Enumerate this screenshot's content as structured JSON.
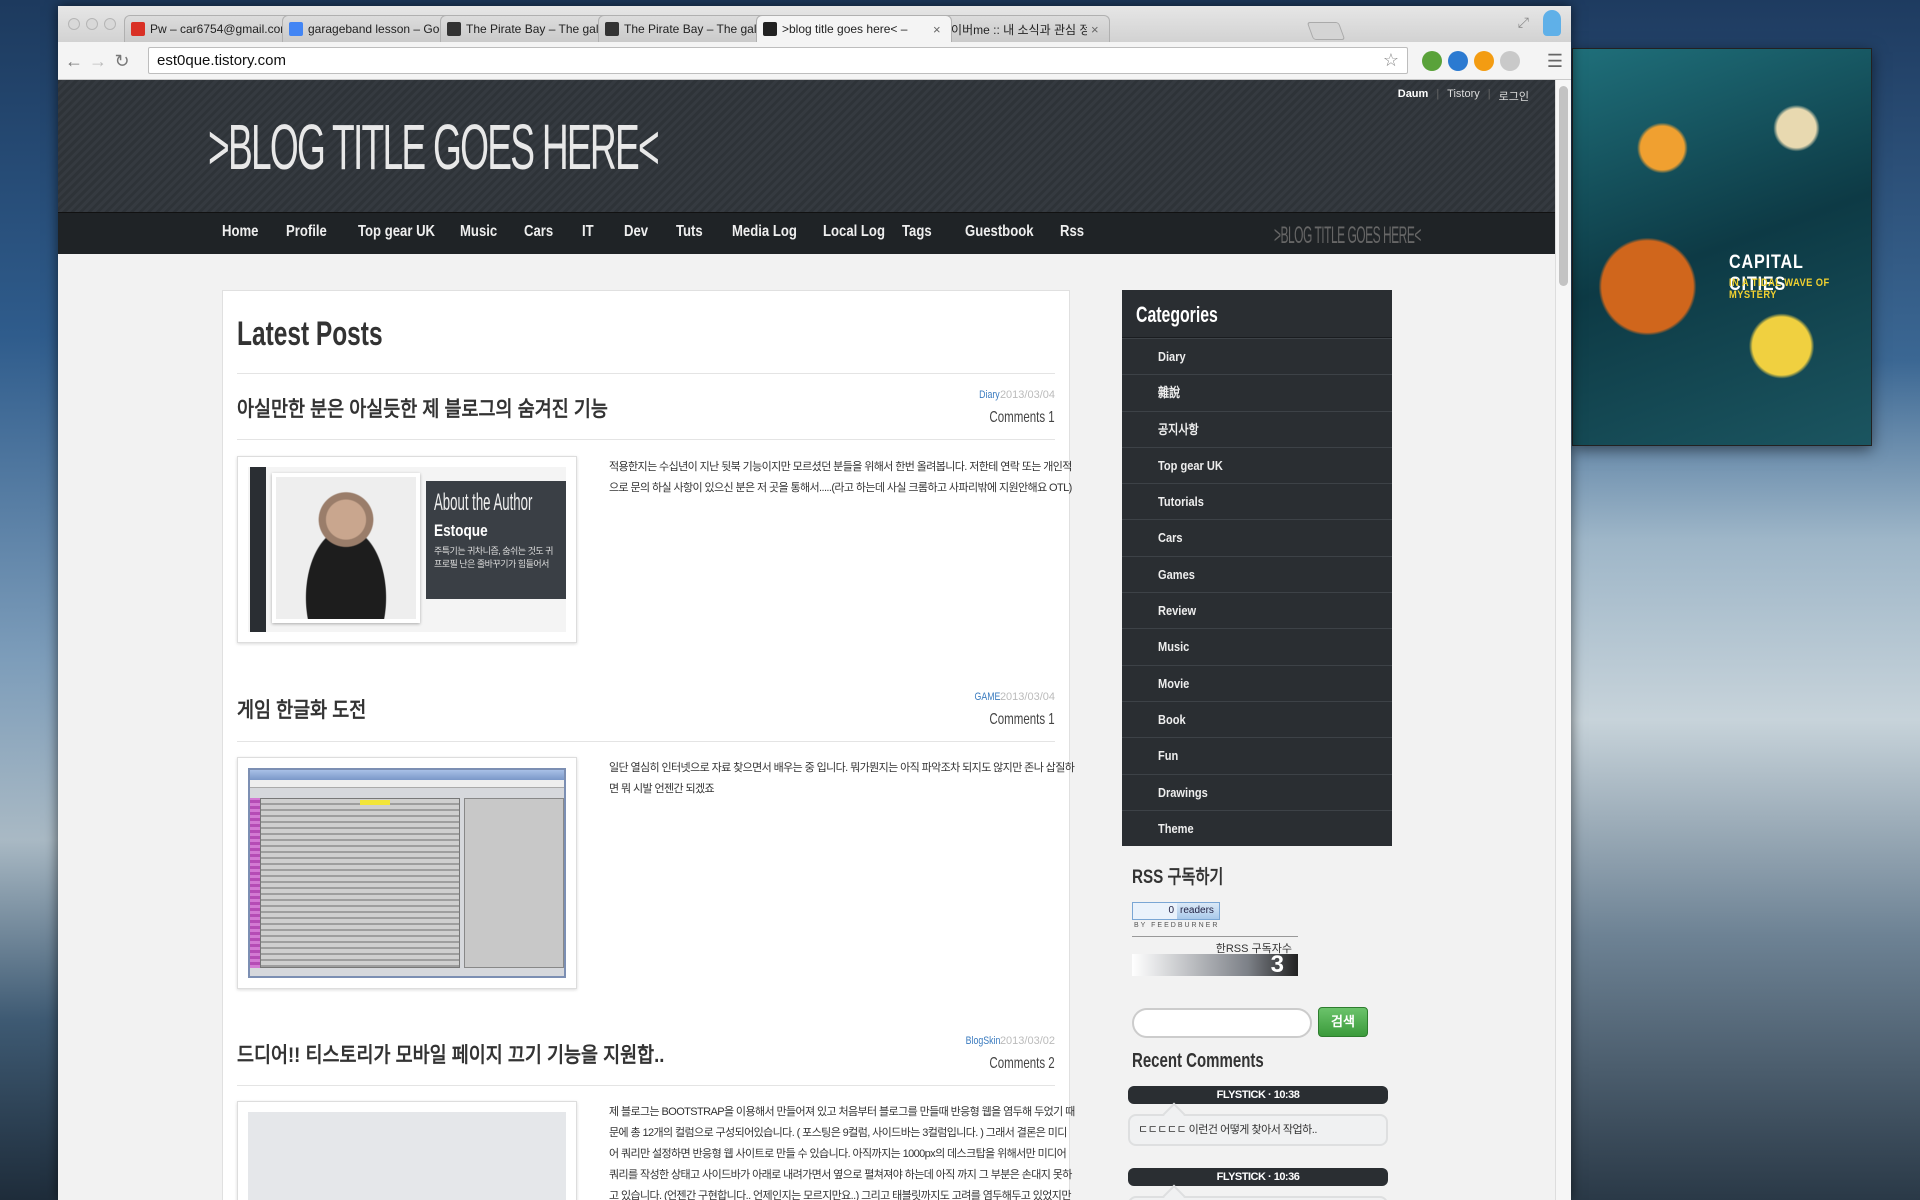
{
  "browser": {
    "tabs": [
      {
        "title": "Pw – car6754@gmail.com",
        "icon": "gmail-icon",
        "color": "#d93025"
      },
      {
        "title": "garageband lesson – Goog",
        "icon": "google-icon",
        "color": "#4285f4"
      },
      {
        "title": "The Pirate Bay – The galaxy",
        "icon": "pirate-ship-icon",
        "color": "#333333"
      },
      {
        "title": "The Pirate Bay – The galaxy",
        "icon": "pirate-ship-icon",
        "color": "#333333"
      },
      {
        "title": ">blog title goes here< –",
        "icon": "blog-icon",
        "color": "#222222"
      },
      {
        "title": "네이버me :: 내 소식과 관심 정",
        "icon": "naver-me-icon",
        "color": "#2db400"
      }
    ],
    "active_tab": 4,
    "url": "est0que.tistory.com"
  },
  "desktop": {
    "album_title": "CAPITAL CITIES",
    "album_subtitle": "IN A TIDAL WAVE OF MYSTERY"
  },
  "site": {
    "toplinks": [
      "Daum",
      "Tistory",
      "로그인"
    ],
    "blog_title": ">BLOG TITLE GOES HERE<",
    "nav": [
      "Home",
      "Profile",
      "Top gear UK",
      "Music",
      "Cars",
      "IT",
      "Dev",
      "Tuts",
      "Media Log",
      "Local Log",
      "Tags",
      "Guestbook",
      "Rss"
    ],
    "nav_logo": ">BLOG TITLE GOES HERE<"
  },
  "main": {
    "heading": "Latest Posts",
    "posts": [
      {
        "title": "아실만한 분은 아실듯한 제 블로그의 숨겨진 기능",
        "category": "Diary",
        "date": "2013/03/04",
        "comments": "Comments 1",
        "excerpt": "적용한지는 수십년이 지난 뒷북 기능이지만 모르셨던 분들을 위해서 한번 올려봅니다. 저한테 연락 또는 개인적으로 문의 하실 사항이 있으신 분은 저 곳을 통해서.....(라고 하는데 사실 크롬하고 사파리밖에 지원안해요 OTL)",
        "author_card": {
          "heading": "About the Author",
          "name": "Estoque",
          "desc": "주특기는 귀차니즘, 숨쉬는 것도 귀\n프로필 난은 줄바꾸기가 힘들어서"
        }
      },
      {
        "title": "게임 한글화 도전",
        "category": "GAME",
        "date": "2013/03/04",
        "comments": "Comments 1",
        "excerpt": "일단 열심히 인터넷으로 자료 찾으면서 배우는 중 입니다. 뭐가뭔지는 아직 파악조차 되지도 않지만 존나 삽질하면 뭐 시발 언젠간 되겠죠"
      },
      {
        "title": "드디어!! 티스토리가 모바일 페이지 끄기 기능을 지원합..",
        "category": "BlogSkin",
        "date": "2013/03/02",
        "comments": "Comments 2",
        "excerpt": "제 블로그는 BOOTSTRAP을 이용해서 만들어져 있고 처음부터 블로그를 만들때 반응형 웹을 염두해 두었기 때문에 총 12개의 컬럼으로 구성되어있습니다. ( 포스팅은 9컬럼, 사이드바는 3컬럼입니다. ) 그래서 결론은 미디어 쿼리만 설정하면 반응형 웹 사이트로 만들 수 있습니다. 아직까지는 1000px의 데스크탑을 위해서만 미디어 쿼리를 작성한 상태고 사이드바가 아래로 내려가면서 옆으로 펼쳐져야 하는데 아직 까지 그 부분은 손대지 못하고 있습니다. (언젠간 구현합니다.. 언제인지는 모르지만요..) 그리고 태블릿까지도 고려를 염두해두고 있었지만 해도폰을 위한 모바일 페이"
      }
    ]
  },
  "sidebar": {
    "categories_title": "Categories",
    "categories": [
      "Diary",
      "雜說",
      "공지사항",
      "Top gear UK",
      "Tutorials",
      "Cars",
      "Games",
      "Review",
      "Music",
      "Movie",
      "Book",
      "Fun",
      "Drawings",
      "Theme"
    ],
    "rss_title": "RSS 구독하기",
    "feedburner_count": "0",
    "feedburner_label": "readers",
    "feedburner_by": "BY FEEDBURNER",
    "rss_count_label": "한RSS 구독자수",
    "rss_count": "3",
    "search_button": "검색",
    "recent_comments_title": "Recent Comments",
    "recent_comments": [
      {
        "author": "FLYSTICK · 10:38",
        "text": "ㄷㄷㄷㄷㄷ 이런건 어떻게 찾아서 작업하.."
      },
      {
        "author": "FLYSTICK · 10:36",
        "text": ""
      }
    ]
  }
}
